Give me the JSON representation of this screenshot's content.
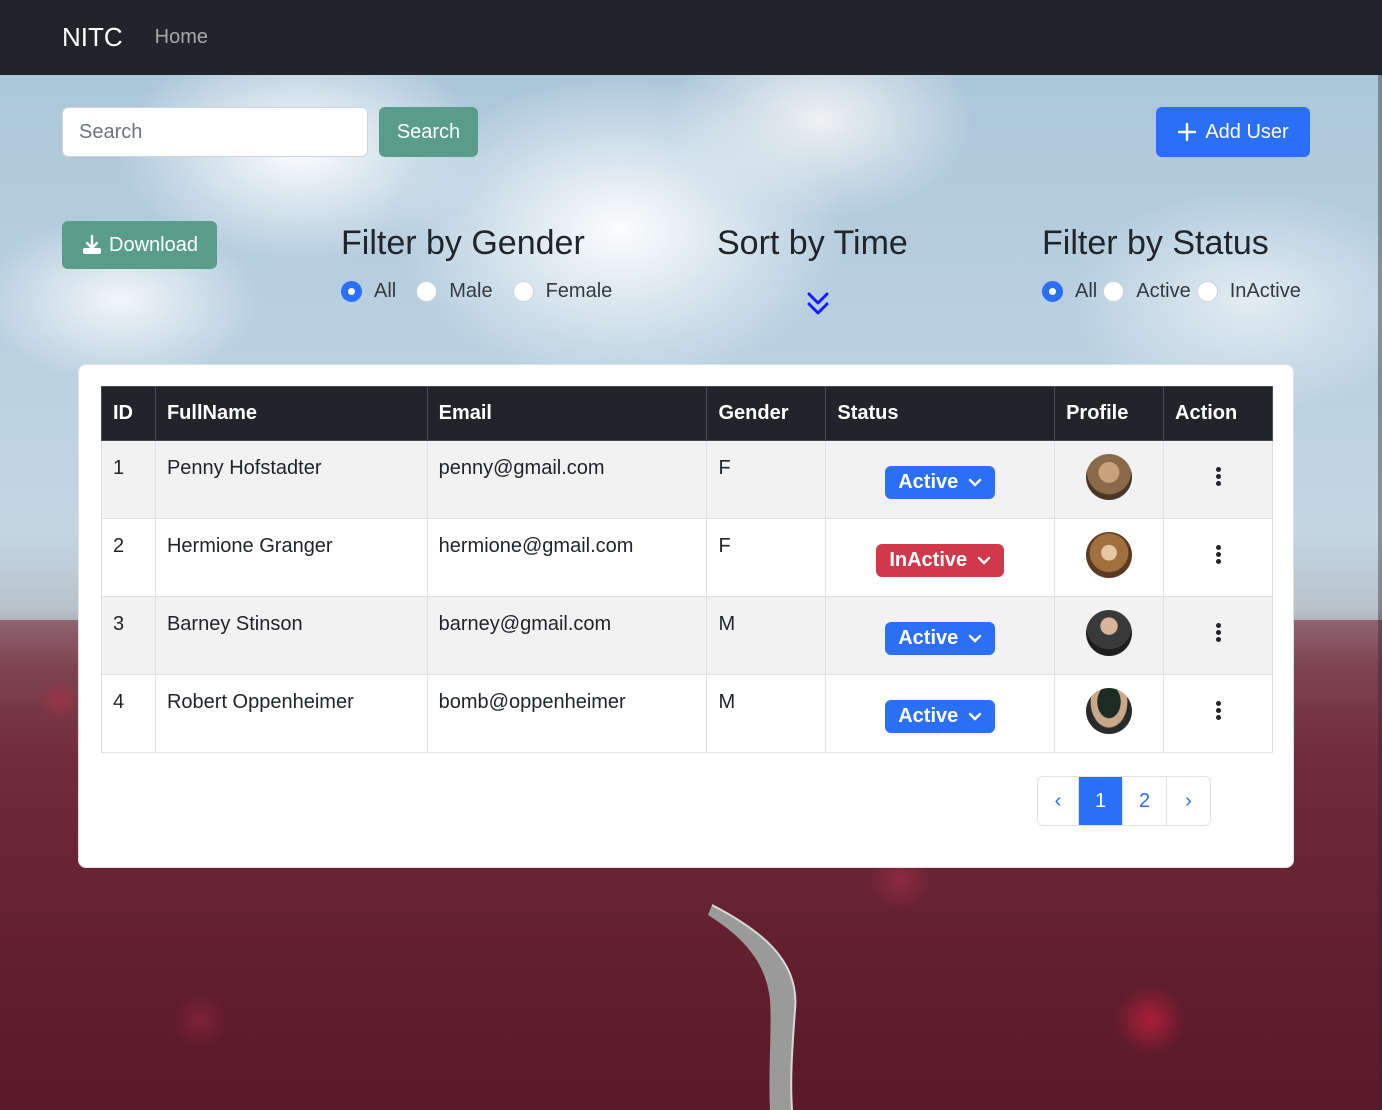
{
  "navbar": {
    "brand": "NITC",
    "links": [
      "Home"
    ]
  },
  "search": {
    "placeholder": "Search",
    "button_label": "Search"
  },
  "add_user": {
    "label": "Add User",
    "icon": "plus-icon"
  },
  "download": {
    "label": "Download",
    "icon": "download-icon"
  },
  "gender_filter": {
    "title": "Filter by Gender",
    "options": [
      "All",
      "Male",
      "Female"
    ],
    "selected": "All"
  },
  "sort": {
    "title": "Sort by Time",
    "icon": "double-chevron-down-icon"
  },
  "status_filter": {
    "title": "Filter by Status",
    "options": [
      "All",
      "Active",
      "InActive"
    ],
    "selected": "All"
  },
  "table": {
    "headers": [
      "ID",
      "FullName",
      "Email",
      "Gender",
      "Status",
      "Profile",
      "Action"
    ],
    "rows": [
      {
        "id": "1",
        "fullname": "Penny Hofstadter",
        "email": "penny@gmail.com",
        "gender": "F",
        "status": "Active"
      },
      {
        "id": "2",
        "fullname": "Hermione Granger",
        "email": "hermione@gmail.com",
        "gender": "F",
        "status": "InActive"
      },
      {
        "id": "3",
        "fullname": "Barney Stinson",
        "email": "barney@gmail.com",
        "gender": "M",
        "status": "Active"
      },
      {
        "id": "4",
        "fullname": "Robert Oppenheimer",
        "email": "bomb@oppenheimer",
        "gender": "M",
        "status": "Active"
      }
    ]
  },
  "pagination": {
    "prev": "‹",
    "pages": [
      "1",
      "2"
    ],
    "current": "1",
    "next": "›"
  },
  "colors": {
    "navbar": "#212529",
    "primary": "#2a6ff5",
    "success_muted": "#5a9c8a",
    "danger": "#d1394a"
  }
}
